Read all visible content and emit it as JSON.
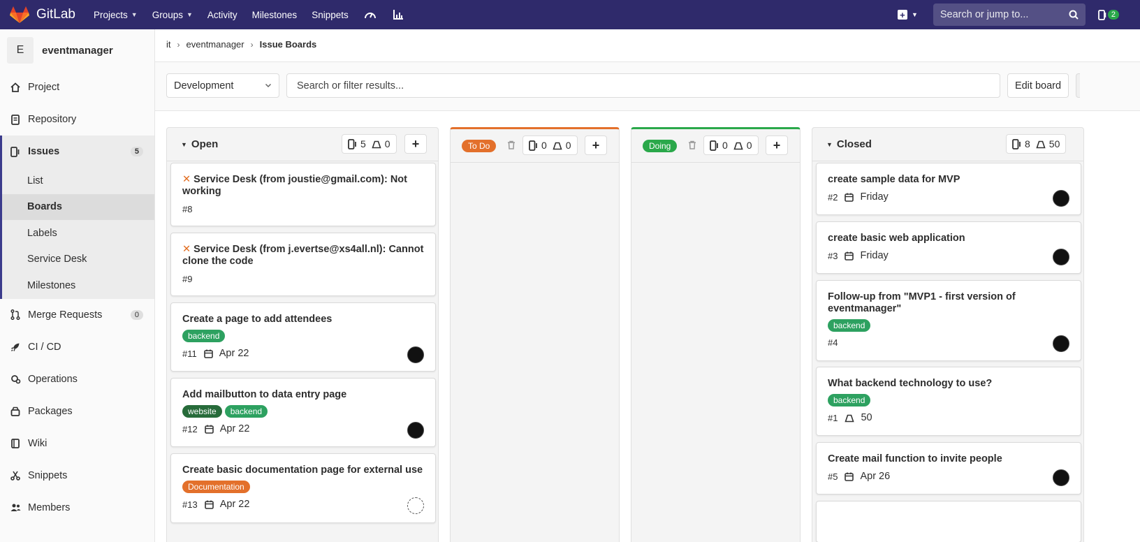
{
  "brand": {
    "name": "GitLab"
  },
  "nav": {
    "items": [
      {
        "label": "Projects",
        "dropdown": true
      },
      {
        "label": "Groups",
        "dropdown": true
      },
      {
        "label": "Activity",
        "dropdown": false
      },
      {
        "label": "Milestones",
        "dropdown": false
      },
      {
        "label": "Snippets",
        "dropdown": false
      }
    ],
    "search_placeholder": "Search or jump to...",
    "todo_count": "2"
  },
  "sidebar": {
    "project_initial": "E",
    "project_name": "eventmanager",
    "items": [
      {
        "label": "Project",
        "icon": "home-icon"
      },
      {
        "label": "Repository",
        "icon": "document-icon"
      },
      {
        "label": "Issues",
        "icon": "issues-icon",
        "count": "5"
      },
      {
        "label": "Merge Requests",
        "icon": "merge-request-icon",
        "count": "0"
      },
      {
        "label": "CI / CD",
        "icon": "rocket-icon"
      },
      {
        "label": "Operations",
        "icon": "cloud-gear-icon"
      },
      {
        "label": "Packages",
        "icon": "package-icon"
      },
      {
        "label": "Wiki",
        "icon": "book-icon"
      },
      {
        "label": "Snippets",
        "icon": "scissors-icon"
      },
      {
        "label": "Members",
        "icon": "users-icon"
      }
    ],
    "issues_sub": [
      "List",
      "Boards",
      "Labels",
      "Service Desk",
      "Milestones"
    ],
    "active_sub": "Boards"
  },
  "breadcrumb": {
    "parts": [
      "it",
      "eventmanager",
      "Issue Boards"
    ]
  },
  "filterbar": {
    "board_name": "Development",
    "search_placeholder": "Search or filter results...",
    "edit_label": "Edit board"
  },
  "colors": {
    "navbar": "#2f2a6b",
    "todo_label": "#e3702b",
    "doing_label": "#2aa84a",
    "backend_label": "#2da160",
    "website_label": "#276b3a",
    "documentation_label": "#e3702b"
  },
  "lists": {
    "open": {
      "title": "Open",
      "issues": "5",
      "weight": "0",
      "cards": [
        {
          "title": "Service Desk (from joustie@gmail.com): Not working",
          "service_desk": true,
          "number": "#8"
        },
        {
          "title": "Service Desk (from j.evertse@xs4all.nl): Cannot clone the code",
          "service_desk": true,
          "number": "#9"
        },
        {
          "title": "Create a page to add attendees",
          "labels": [
            "backend"
          ],
          "number": "#11",
          "due": "Apr 22"
        },
        {
          "title": "Add mailbutton to data entry page",
          "labels": [
            "website",
            "backend"
          ],
          "number": "#12",
          "due": "Apr 22"
        },
        {
          "title": "Create basic documentation page for external use",
          "labels": [
            "Documentation"
          ],
          "number": "#13",
          "due": "Apr 22"
        }
      ]
    },
    "todo": {
      "title": "To Do",
      "issues": "0",
      "weight": "0"
    },
    "doing": {
      "title": "Doing",
      "issues": "0",
      "weight": "0"
    },
    "closed": {
      "title": "Closed",
      "issues": "8",
      "weight": "50",
      "cards": [
        {
          "title": "create sample data for MVP",
          "number": "#2",
          "due": "Friday"
        },
        {
          "title": "create basic web application",
          "number": "#3",
          "due": "Friday"
        },
        {
          "title": "Follow-up from \"MVP1 - first version of eventmanager\"",
          "labels": [
            "backend"
          ],
          "number": "#4"
        },
        {
          "title": "What backend technology to use?",
          "labels": [
            "backend"
          ],
          "number": "#1",
          "weight": "50"
        },
        {
          "title": "Create mail function to invite people",
          "number": "#5",
          "due": "Apr 26"
        }
      ]
    }
  }
}
